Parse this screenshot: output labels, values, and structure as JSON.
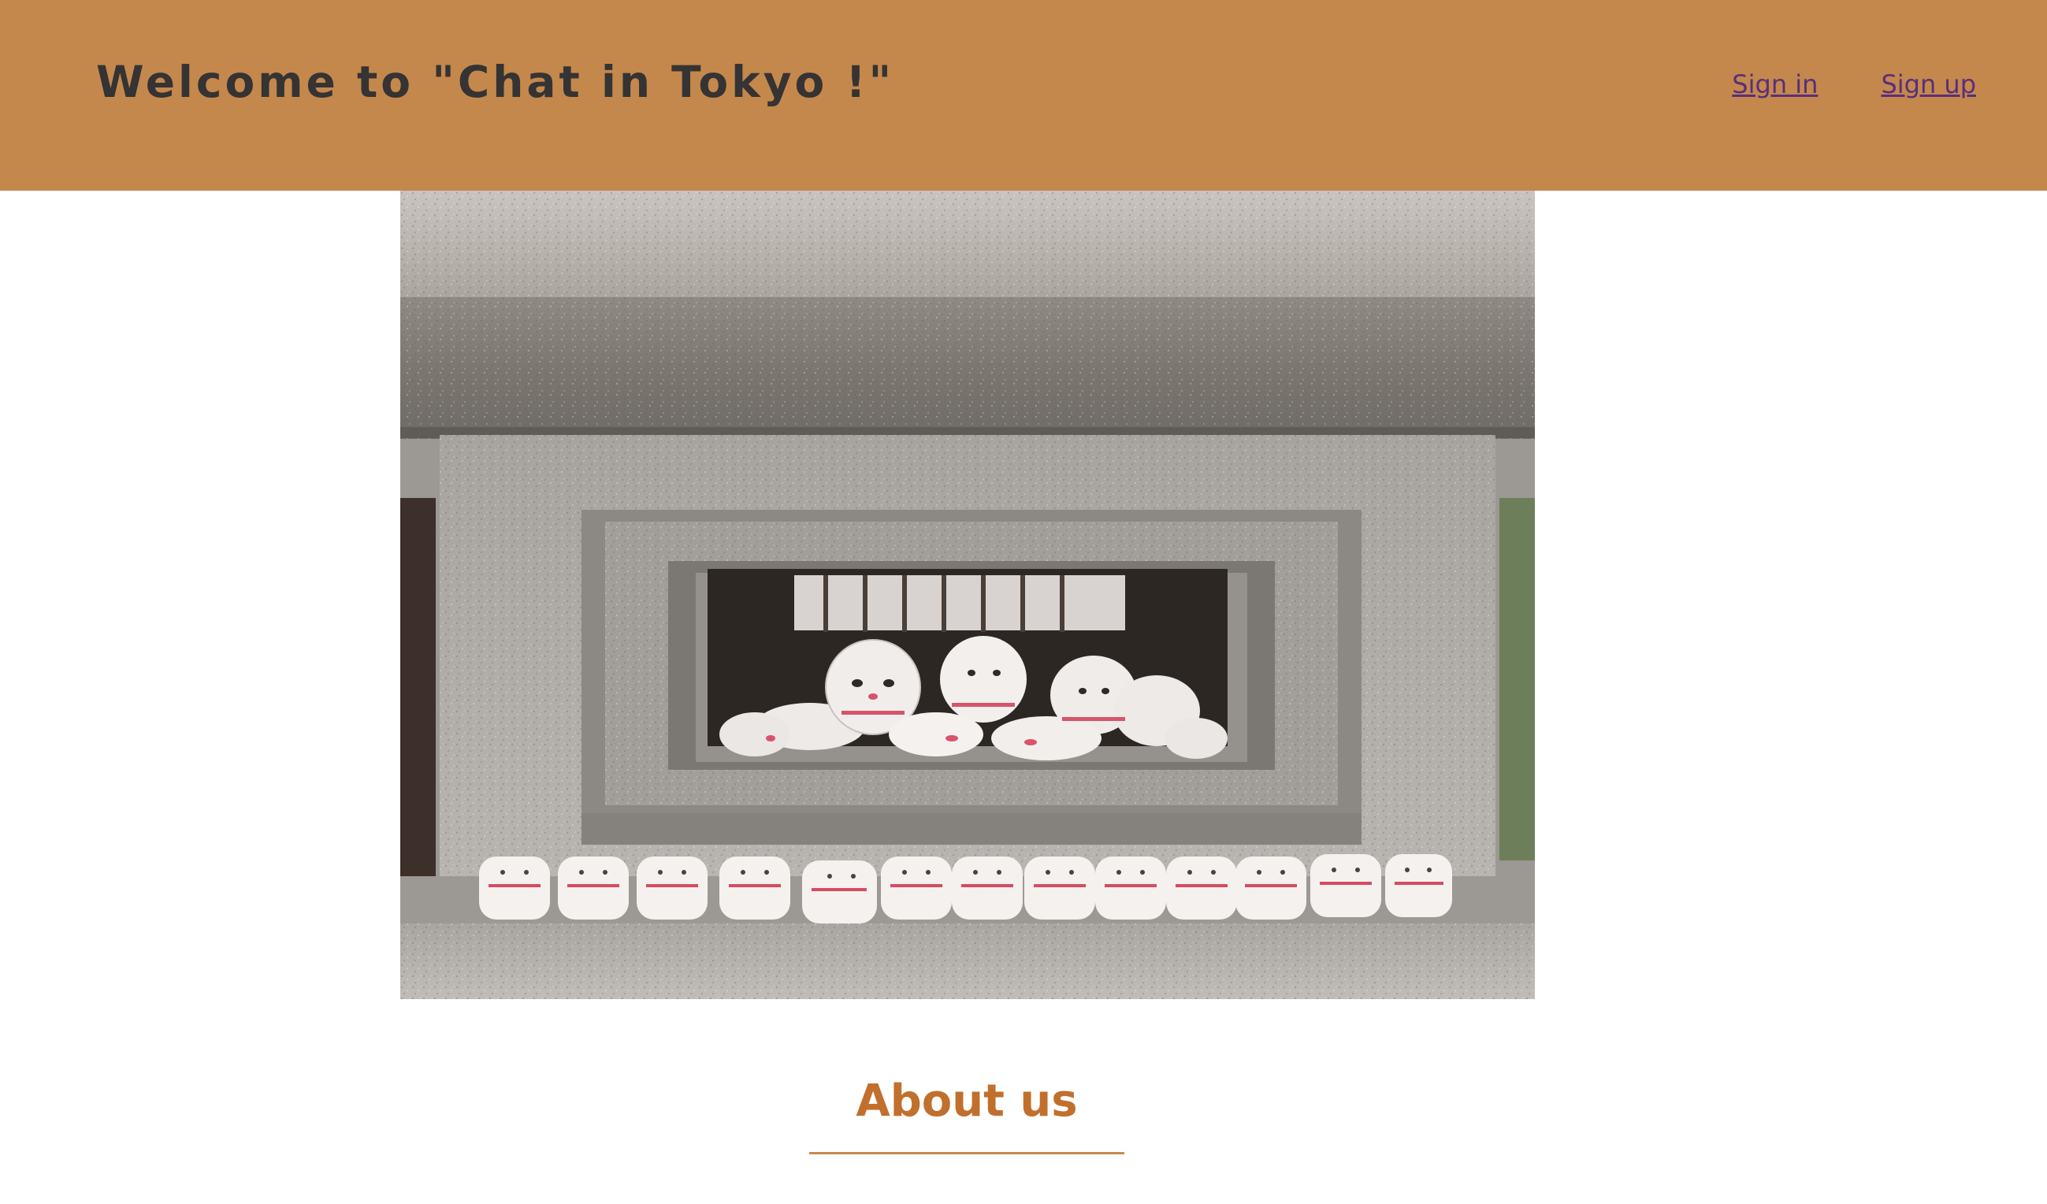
{
  "header": {
    "title": "Welcome to \"Chat in Tokyo !\"",
    "background_color": "#c4884c",
    "nav": [
      {
        "label": "Sign in"
      },
      {
        "label": "Sign up"
      }
    ]
  },
  "hero": {
    "subject": "stone lantern with maneki-neko cat figurines"
  },
  "about": {
    "heading": "About us",
    "accent_color": "#c16f2d"
  }
}
